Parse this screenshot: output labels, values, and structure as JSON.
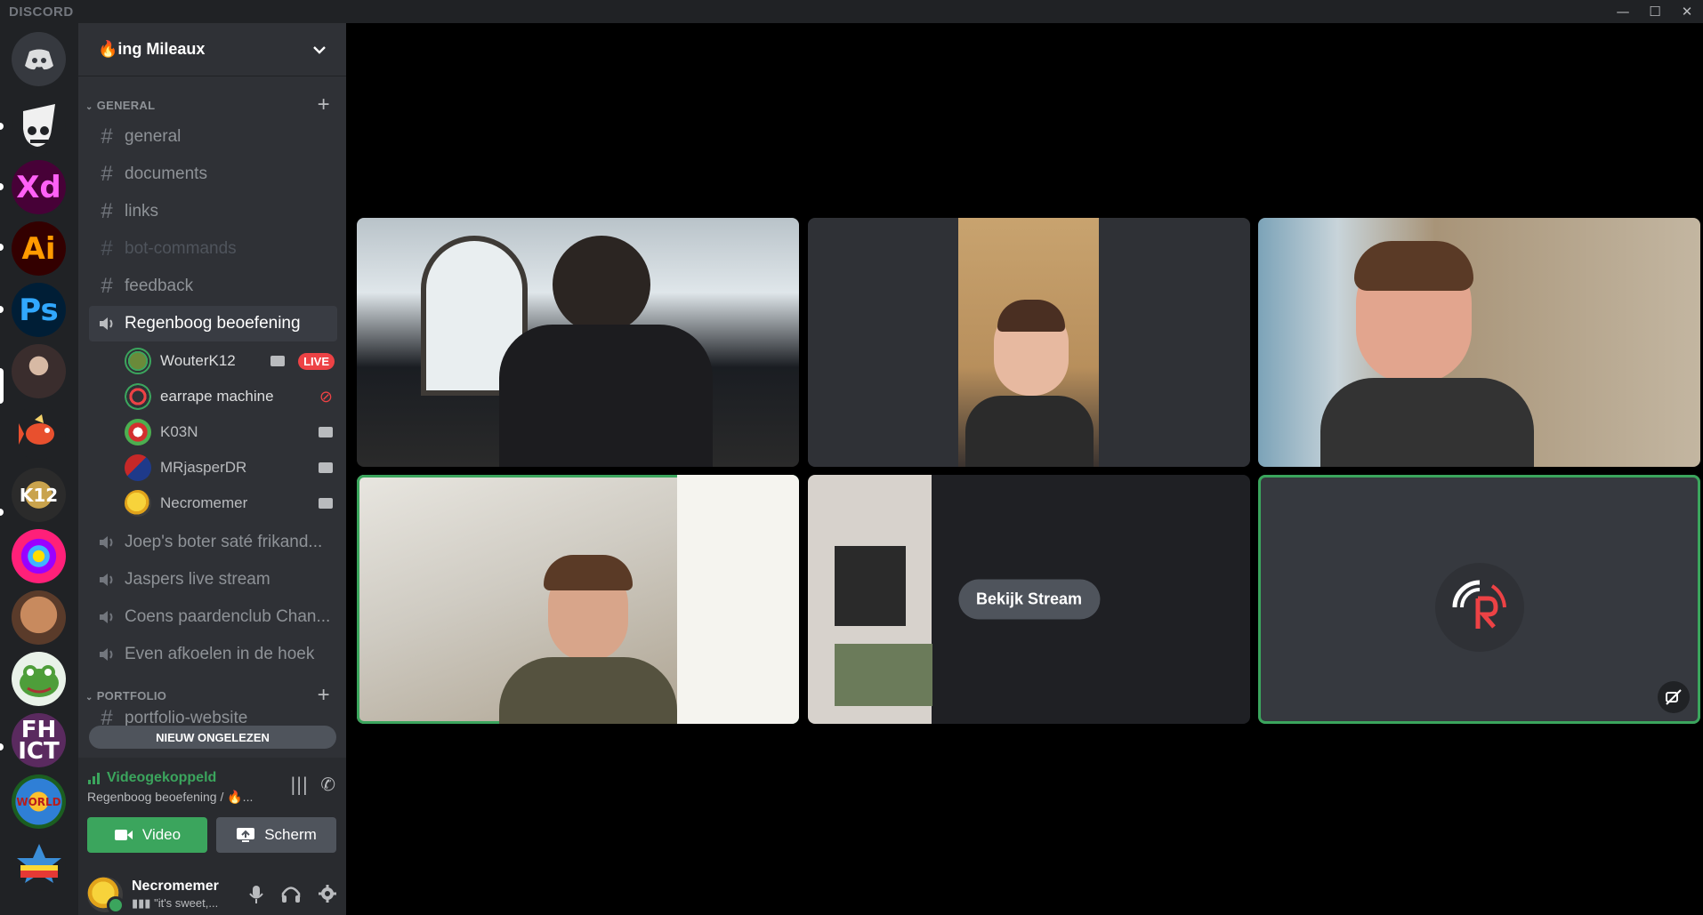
{
  "app": {
    "brand": "DISCORD"
  },
  "window": {
    "minimize": "—",
    "maximize": "☐",
    "close": "✕"
  },
  "guild": {
    "name": "🔥ing Mileaux"
  },
  "categories": {
    "general": "GENERAL",
    "portfolio": "PORTFOLIO"
  },
  "channels": {
    "general": "general",
    "documents": "documents",
    "links": "links",
    "bot_commands": "bot-commands",
    "feedback": "feedback"
  },
  "voice_channels": [
    {
      "name": "Regenboog beoefening"
    },
    {
      "name": "Joep's boter saté frikand..."
    },
    {
      "name": "Jaspers live stream"
    },
    {
      "name": "Coens paardenclub Chan..."
    },
    {
      "name": "Even afkoelen in de hoek"
    }
  ],
  "voice_users": [
    {
      "name": "WouterK12",
      "live": "LIVE"
    },
    {
      "name": "earrape machine"
    },
    {
      "name": "K03N"
    },
    {
      "name": "MRjasperDR"
    },
    {
      "name": "Necromemer"
    }
  ],
  "portfolio_partial_channel": "portfolio-website",
  "unread_banner": "NIEUW ONGELEZEN",
  "voice_panel": {
    "status": "Videogekoppeld",
    "channel": "Regenboog beoefening / 🔥...",
    "video_button": "Video",
    "screen_button": "Scherm"
  },
  "user_panel": {
    "name": "Necromemer",
    "status": "\"it's sweet,..."
  },
  "stage": {
    "watch_stream": "Bekijk Stream"
  },
  "colors": {
    "accent_green": "#3ba55d",
    "live_red": "#ed4245",
    "blurple": "#5865f2"
  }
}
